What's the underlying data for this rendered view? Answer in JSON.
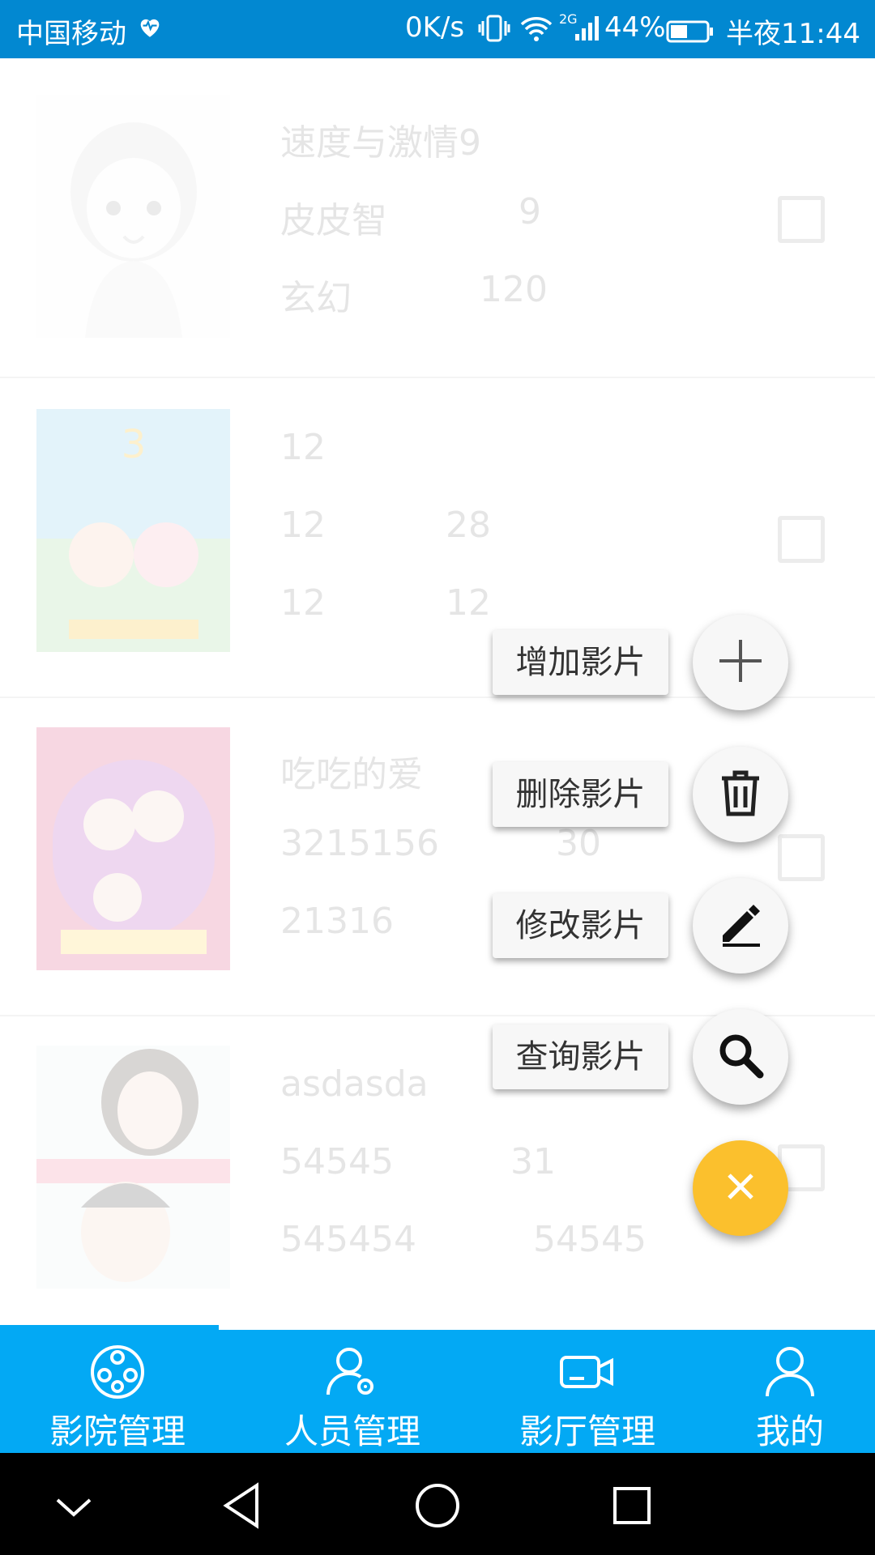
{
  "status_bar": {
    "carrier": "中国移动",
    "net_speed": "0K/s",
    "network_type": "2G",
    "battery": "44%",
    "time": "半夜11:44",
    "color": "#0288d1"
  },
  "movies": [
    {
      "title": "速度与激情9",
      "director": "皮皮智",
      "score": "9",
      "genre": "玄幻",
      "duration": "120",
      "checked": false
    },
    {
      "title": "12",
      "director": "12",
      "score": "28",
      "genre": "12",
      "duration": "12",
      "checked": false
    },
    {
      "title": "吃吃的爱",
      "director": "3215156",
      "score": "30",
      "genre": "21316",
      "duration": "",
      "checked": false
    },
    {
      "title": "asdasda",
      "director": "54545",
      "score": "31",
      "genre": "545454",
      "duration": "54545",
      "checked": false
    }
  ],
  "fab_menu": {
    "add_label": "增加影片",
    "delete_label": "删除影片",
    "edit_label": "修改影片",
    "query_label": "查询影片",
    "main_color": "#fbc02d",
    "icons": [
      "plus-icon",
      "trash-icon",
      "pencil-icon",
      "search-icon",
      "close-icon"
    ]
  },
  "bottom_nav": {
    "color": "#03a9f4",
    "tabs": [
      {
        "label": "影院管理",
        "icon": "film-reel-icon",
        "active": true
      },
      {
        "label": "人员管理",
        "icon": "user-gear-icon",
        "active": false
      },
      {
        "label": "影厅管理",
        "icon": "video-camera-icon",
        "active": false
      },
      {
        "label": "我的",
        "icon": "user-icon",
        "active": false
      }
    ]
  }
}
